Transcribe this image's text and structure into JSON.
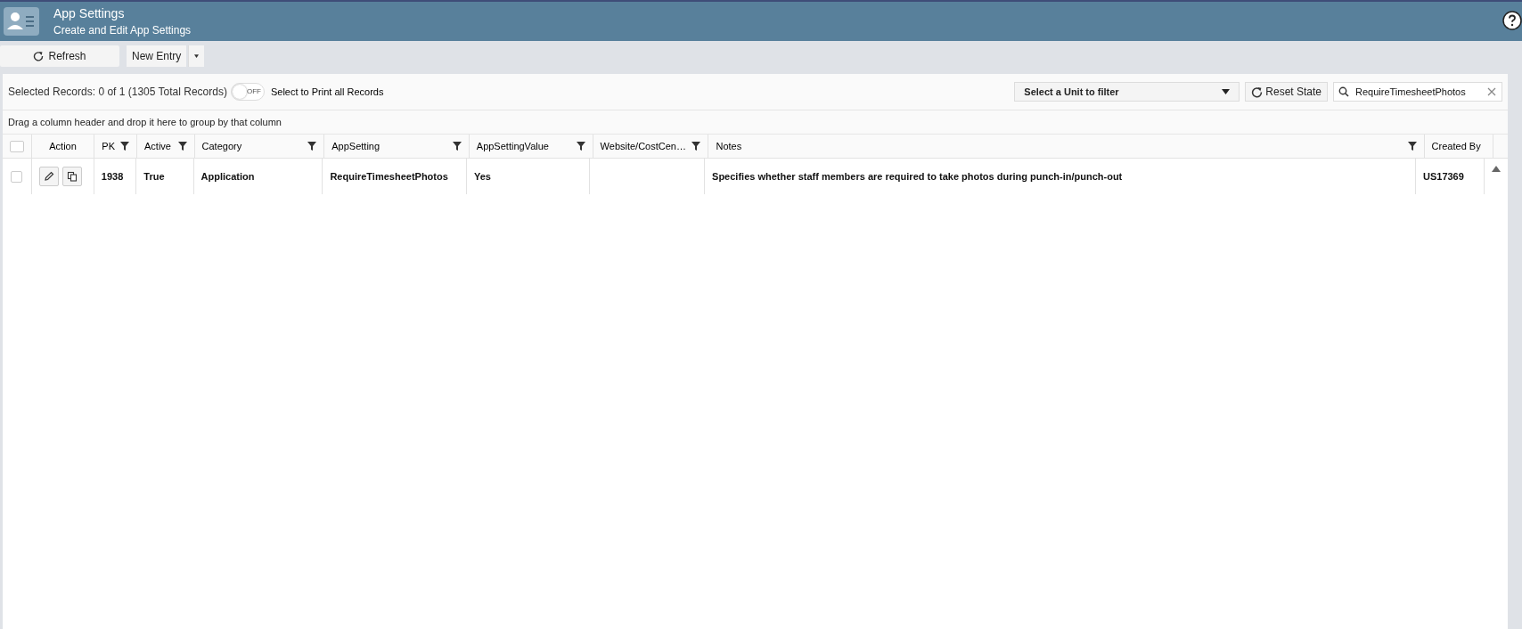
{
  "header": {
    "title": "App Settings",
    "subtitle": "Create and Edit App Settings"
  },
  "toolbar": {
    "refresh": "Refresh",
    "new_entry": "New Entry"
  },
  "grid_toolbar": {
    "selected_text": "Selected Records: 0 of 1 (1305 Total Records)",
    "print_toggle": {
      "on": false,
      "label": "OFF"
    },
    "print_label": "Select to Print all Records",
    "unit_filter": "Select a Unit to filter",
    "reset": "Reset State",
    "search": "RequireTimesheetPhotos"
  },
  "group_hint": "Drag a column header and drop it here to group by that column",
  "table": {
    "select_all": {
      "checked": false
    },
    "columns": [
      {
        "label": "Action",
        "filter": false
      },
      {
        "label": "PK",
        "filter": true
      },
      {
        "label": "Active",
        "filter": true
      },
      {
        "label": "Category",
        "filter": true
      },
      {
        "label": "AppSetting",
        "filter": true
      },
      {
        "label": "AppSettingValue",
        "filter": true
      },
      {
        "label": "Website/CostCen…",
        "filter": true
      },
      {
        "label": "Notes",
        "filter": true
      },
      {
        "label": "Created By",
        "filter": false
      }
    ],
    "rows": [
      {
        "checked": false,
        "cells": [
          "",
          "1938",
          "True",
          "Application",
          "RequireTimesheetPhotos",
          "Yes",
          "",
          "Specifies whether staff members are required to take photos during punch-in/punch-out",
          "US17369"
        ]
      }
    ]
  }
}
